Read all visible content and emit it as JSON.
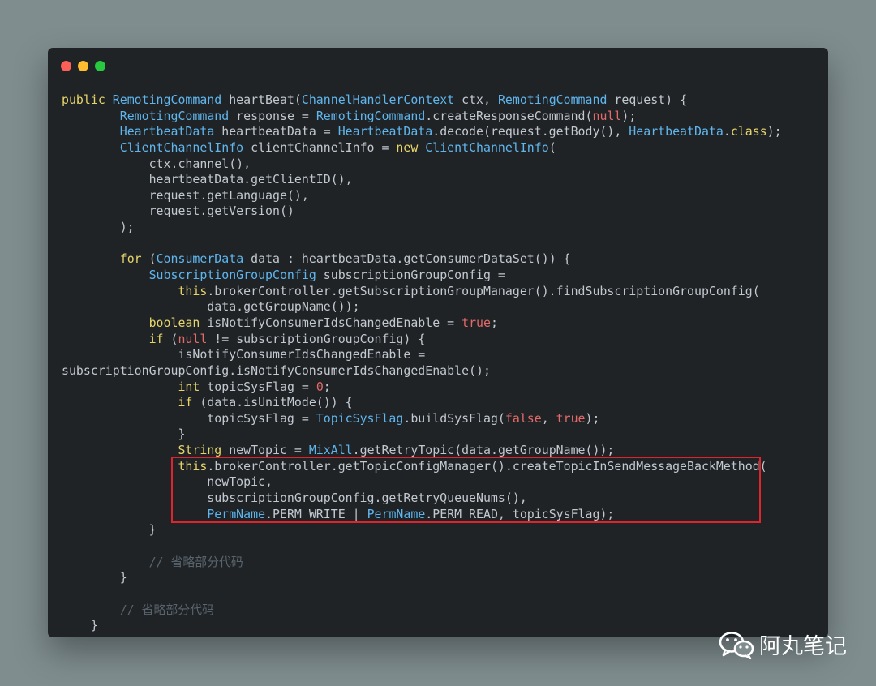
{
  "window": {
    "controls": [
      {
        "name": "close",
        "color": "#fe5f57"
      },
      {
        "name": "minimize",
        "color": "#febc2e"
      },
      {
        "name": "maximize",
        "color": "#28c840"
      }
    ]
  },
  "colors": {
    "background": "#7f8d8f",
    "editor": "#1f2326",
    "default": "#c2c8cf",
    "keyword": "#e7d56a",
    "type": "#5fb6ee",
    "literal": "#e46a6a",
    "comment": "#59646d",
    "highlight_border": "#e0242e"
  },
  "code_lines": [
    [
      [
        "k",
        "public"
      ],
      [
        "d",
        " "
      ],
      [
        "t",
        "RemotingCommand"
      ],
      [
        "d",
        " heartBeat("
      ],
      [
        "t",
        "ChannelHandlerContext"
      ],
      [
        "d",
        " ctx, "
      ],
      [
        "t",
        "RemotingCommand"
      ],
      [
        "d",
        " request) {"
      ]
    ],
    [
      [
        "d",
        "        "
      ],
      [
        "t",
        "RemotingCommand"
      ],
      [
        "d",
        " response = "
      ],
      [
        "t",
        "RemotingCommand"
      ],
      [
        "d",
        ".createResponseCommand("
      ],
      [
        "l",
        "null"
      ],
      [
        "d",
        ");"
      ]
    ],
    [
      [
        "d",
        "        "
      ],
      [
        "t",
        "HeartbeatData"
      ],
      [
        "d",
        " heartbeatData = "
      ],
      [
        "t",
        "HeartbeatData"
      ],
      [
        "d",
        ".decode(request.getBody(), "
      ],
      [
        "t",
        "HeartbeatData"
      ],
      [
        "d",
        "."
      ],
      [
        "k",
        "class"
      ],
      [
        "d",
        ");"
      ]
    ],
    [
      [
        "d",
        "        "
      ],
      [
        "t",
        "ClientChannelInfo"
      ],
      [
        "d",
        " clientChannelInfo = "
      ],
      [
        "k",
        "new"
      ],
      [
        "d",
        " "
      ],
      [
        "t",
        "ClientChannelInfo"
      ],
      [
        "d",
        "("
      ]
    ],
    [
      [
        "d",
        "            ctx.channel(),"
      ]
    ],
    [
      [
        "d",
        "            heartbeatData.getClientID(),"
      ]
    ],
    [
      [
        "d",
        "            request.getLanguage(),"
      ]
    ],
    [
      [
        "d",
        "            request.getVersion()"
      ]
    ],
    [
      [
        "d",
        "        );"
      ]
    ],
    [],
    [
      [
        "d",
        "        "
      ],
      [
        "k",
        "for"
      ],
      [
        "d",
        " ("
      ],
      [
        "t",
        "ConsumerData"
      ],
      [
        "d",
        " data : heartbeatData.getConsumerDataSet()) {"
      ]
    ],
    [
      [
        "d",
        "            "
      ],
      [
        "t",
        "SubscriptionGroupConfig"
      ],
      [
        "d",
        " subscriptionGroupConfig ="
      ]
    ],
    [
      [
        "d",
        "                "
      ],
      [
        "k",
        "this"
      ],
      [
        "d",
        ".brokerController.getSubscriptionGroupManager().findSubscriptionGroupConfig("
      ]
    ],
    [
      [
        "d",
        "                    data.getGroupName());"
      ]
    ],
    [
      [
        "d",
        "            "
      ],
      [
        "k",
        "boolean"
      ],
      [
        "d",
        " isNotifyConsumerIdsChangedEnable = "
      ],
      [
        "l",
        "true"
      ],
      [
        "d",
        ";"
      ]
    ],
    [
      [
        "d",
        "            "
      ],
      [
        "k",
        "if"
      ],
      [
        "d",
        " ("
      ],
      [
        "l",
        "null"
      ],
      [
        "d",
        " != subscriptionGroupConfig) {"
      ]
    ],
    [
      [
        "d",
        "                isNotifyConsumerIdsChangedEnable ="
      ]
    ],
    [
      [
        "d",
        "subscriptionGroupConfig.isNotifyConsumerIdsChangedEnable();"
      ]
    ],
    [
      [
        "d",
        "                "
      ],
      [
        "k",
        "int"
      ],
      [
        "d",
        " topicSysFlag = "
      ],
      [
        "l",
        "0"
      ],
      [
        "d",
        ";"
      ]
    ],
    [
      [
        "d",
        "                "
      ],
      [
        "k",
        "if"
      ],
      [
        "d",
        " (data.isUnitMode()) {"
      ]
    ],
    [
      [
        "d",
        "                    topicSysFlag = "
      ],
      [
        "t",
        "TopicSysFlag"
      ],
      [
        "d",
        ".buildSysFlag("
      ],
      [
        "l",
        "false"
      ],
      [
        "d",
        ", "
      ],
      [
        "l",
        "true"
      ],
      [
        "d",
        ");"
      ]
    ],
    [
      [
        "d",
        "                }"
      ]
    ],
    [
      [
        "d",
        "                "
      ],
      [
        "k",
        "String"
      ],
      [
        "d",
        " newTopic = "
      ],
      [
        "t",
        "MixAll"
      ],
      [
        "d",
        ".getRetryTopic(data.getGroupName());"
      ]
    ],
    [
      [
        "d",
        "                "
      ],
      [
        "k",
        "this"
      ],
      [
        "d",
        ".brokerController.getTopicConfigManager().createTopicInSendMessageBackMethod("
      ]
    ],
    [
      [
        "d",
        "                    newTopic,"
      ]
    ],
    [
      [
        "d",
        "                    subscriptionGroupConfig.getRetryQueueNums(),"
      ]
    ],
    [
      [
        "d",
        "                    "
      ],
      [
        "t",
        "PermName"
      ],
      [
        "d",
        ".PERM_WRITE | "
      ],
      [
        "t",
        "PermName"
      ],
      [
        "d",
        ".PERM_READ, topicSysFlag);"
      ]
    ],
    [
      [
        "d",
        "            }"
      ]
    ],
    [],
    [
      [
        "c",
        "            // 省略部分代码"
      ]
    ],
    [
      [
        "d",
        "        }"
      ]
    ],
    [],
    [
      [
        "c",
        "        // 省略部分代码"
      ]
    ],
    [
      [
        "d",
        "    }"
      ]
    ]
  ],
  "watermark": {
    "icon": "wechat-icon",
    "text": "阿丸笔记"
  }
}
